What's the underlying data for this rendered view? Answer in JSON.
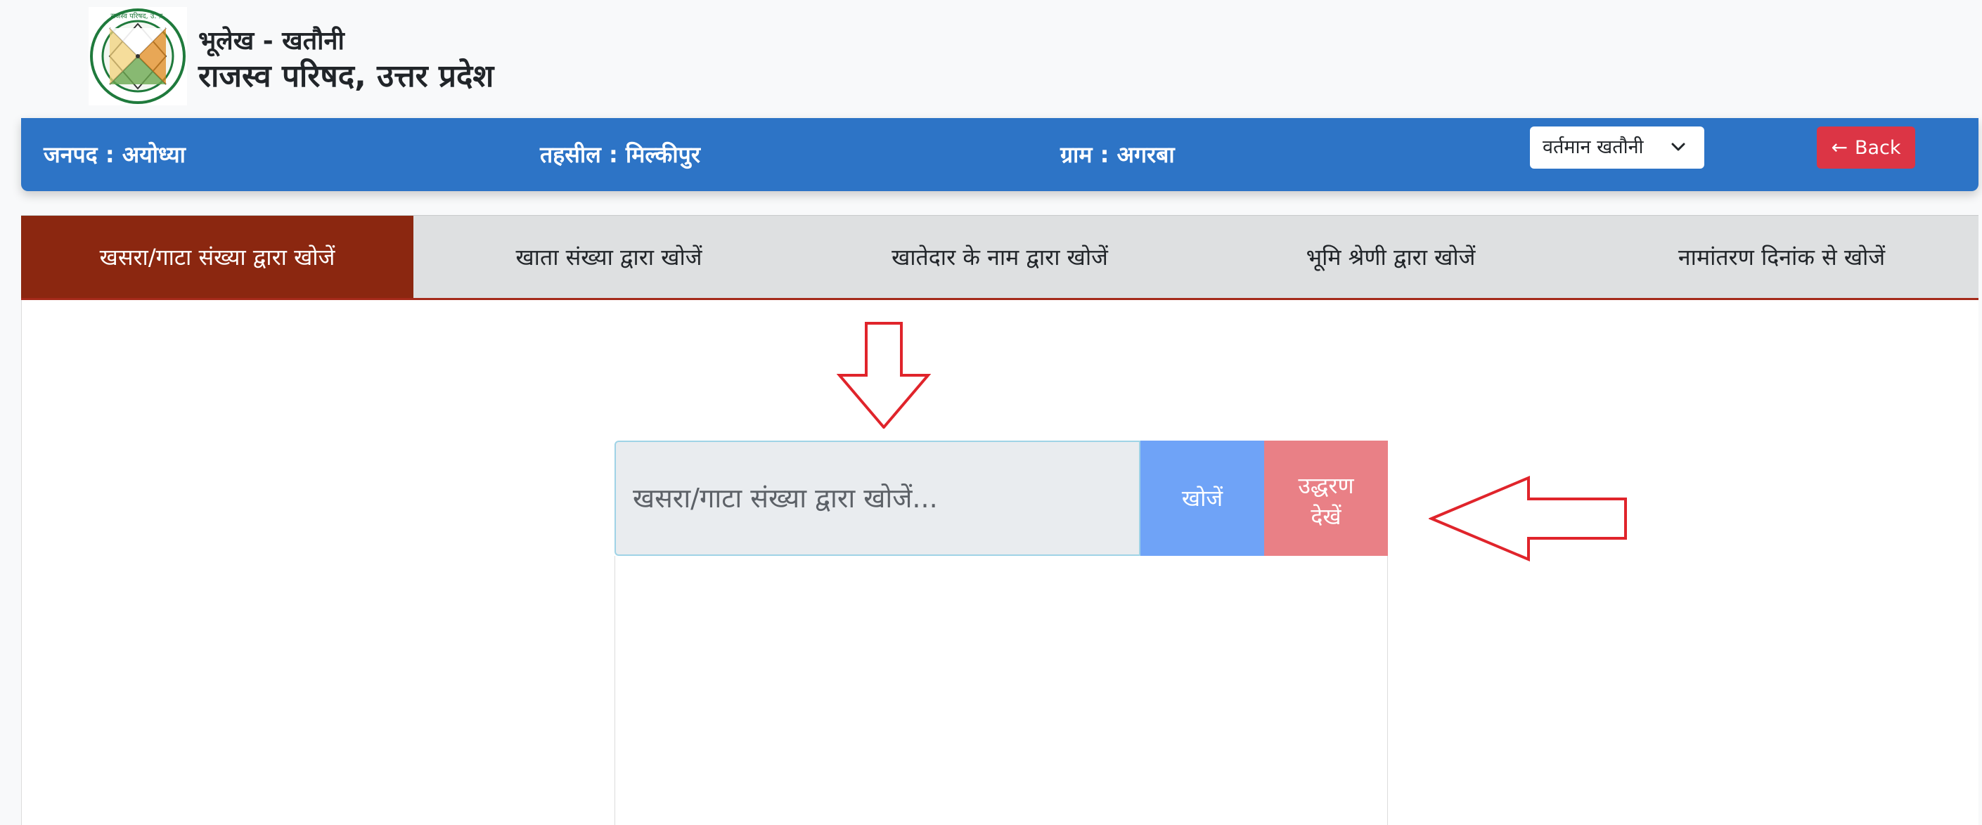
{
  "header": {
    "subtitle": "भूलेख - खतौनी",
    "title": "राजस्व परिषद, उत्तर प्रदेश",
    "logo_text": "राजस्व परिषद, उ. प्र."
  },
  "info_bar": {
    "district": "जनपद : अयोध्या",
    "tehsil": "तहसील : मिल्कीपुर",
    "village": "ग्राम : अगरबा",
    "khatauni_select": "वर्तमान खतौनी",
    "back_label": "Back",
    "back_icon": "arrow-left-icon",
    "select_icon": "chevron-down-icon"
  },
  "tabs": [
    {
      "label": "खसरा/गाटा संख्या द्वारा खोजें",
      "active": true
    },
    {
      "label": "खाता संख्या द्वारा खोजें",
      "active": false
    },
    {
      "label": "खातेदार के नाम द्वारा खोजें",
      "active": false
    },
    {
      "label": "भूमि श्रेणी द्वारा खोजें",
      "active": false
    },
    {
      "label": "नामांतरण दिनांक से खोजें",
      "active": false
    }
  ],
  "search": {
    "placeholder": "खसरा/गाटा संख्या द्वारा खोजें...",
    "value": "",
    "search_label": "खोजें",
    "extract_line1": "उद्धरण",
    "extract_line2": "देखें"
  },
  "colors": {
    "info_bar": "#2d74c6",
    "active_tab": "#8b2710",
    "tab_bg": "#dee0e1",
    "search_button": "#6fa3f7",
    "extract_button": "#e98086",
    "back_button": "#dc3545",
    "annotation_arrow": "#e0242b"
  }
}
